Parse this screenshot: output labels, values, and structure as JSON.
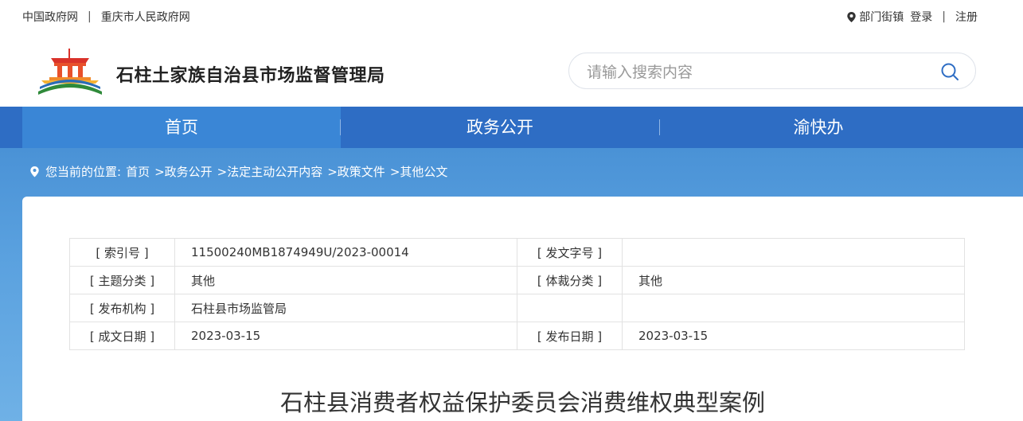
{
  "topbar": {
    "gov_link": "中国政府网",
    "sep1": "|",
    "cq_link": "重庆市人民政府网",
    "dept_link": "部门街镇",
    "login_link": "登录",
    "sep2": "|",
    "register_link": "注册"
  },
  "header": {
    "site_title": "石柱土家族自治县市场监督管理局",
    "search_placeholder": "请输入搜索内容"
  },
  "nav": {
    "items": [
      "首页",
      "政务公开",
      "渝快办"
    ],
    "active_index": 0
  },
  "breadcrumb": {
    "prefix": "您当前的位置:",
    "items": [
      "首页",
      ">政务公开",
      ">法定主动公开内容",
      ">政策文件",
      ">其他公文"
    ]
  },
  "meta_table": {
    "rows": [
      [
        "[ 索引号 ]",
        "11500240MB1874949U/2023-00014",
        "[ 发文字号 ]",
        ""
      ],
      [
        "[ 主题分类 ]",
        "其他",
        "[ 体裁分类 ]",
        "其他"
      ],
      [
        "[ 发布机构 ]",
        "石柱县市场监管局",
        "",
        ""
      ],
      [
        "[ 成文日期 ]",
        "2023-03-15",
        "[ 发布日期 ]",
        "2023-03-15"
      ]
    ]
  },
  "document": {
    "title": "石柱县消费者权益保护委员会消费维权典型案例"
  },
  "colors": {
    "nav_bg": "#2e6dc4",
    "nav_active": "#3a86d6",
    "band": "#4a92d6"
  }
}
